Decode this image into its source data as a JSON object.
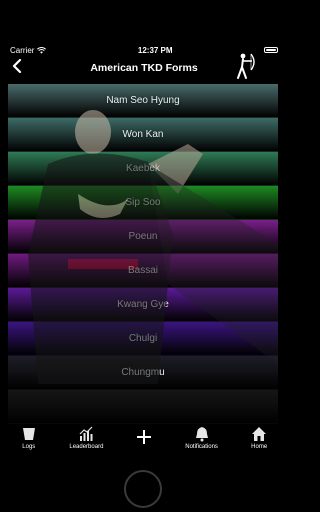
{
  "status_bar": {
    "carrier": "Carrier",
    "time": "12:37 PM"
  },
  "navbar": {
    "title": "American TKD Forms",
    "back_icon": "chevron-left-icon",
    "logo_icon": "archer-icon"
  },
  "forms": [
    {
      "label": "Nam Seo Hyung",
      "color": "#4a6b6b"
    },
    {
      "label": "Won Kan",
      "color": "#3d6b66"
    },
    {
      "label": "Kaebek",
      "color": "#2f7a55"
    },
    {
      "label": "Sip Soo",
      "color": "#1d8a22"
    },
    {
      "label": "Poeun",
      "color": "#7a1f8a"
    },
    {
      "label": "Bassai",
      "color": "#6f1a80"
    },
    {
      "label": "Kwang Gye",
      "color": "#5a1a96"
    },
    {
      "label": "Chulgi",
      "color": "#3a1580"
    },
    {
      "label": "Chungmu",
      "color": "#1e1e28"
    },
    {
      "label": "",
      "color": "#161616"
    }
  ],
  "tabbar": {
    "items": [
      {
        "label": "Logs",
        "icon": "cup-icon"
      },
      {
        "label": "Leaderboard",
        "icon": "bar-chart-icon"
      },
      {
        "label": "",
        "icon": "plus-icon"
      },
      {
        "label": "Notifications",
        "icon": "bell-icon"
      },
      {
        "label": "Home",
        "icon": "house-icon"
      }
    ]
  }
}
